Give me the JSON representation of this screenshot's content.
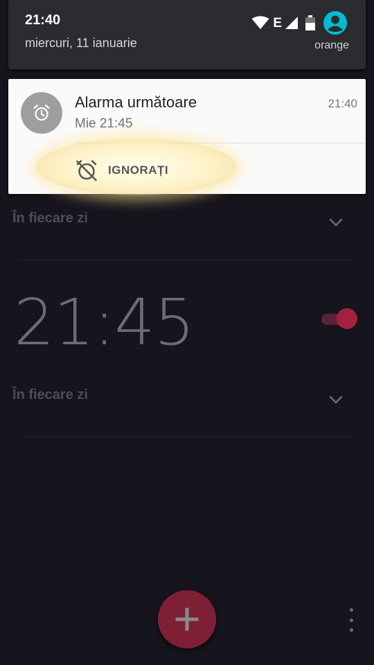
{
  "shade": {
    "time": "21:40",
    "date": "miercuri, 11 ianuarie",
    "carrier": "orange",
    "network_type": "E",
    "icons": [
      "wifi-icon",
      "signal-icon",
      "battery-icon",
      "account-icon"
    ],
    "account_color": "#00bcd4"
  },
  "notification": {
    "title": "Alarma următoare",
    "subtitle": "Mie 21:45",
    "time": "21:40",
    "icon": "alarm-clock-icon",
    "action": {
      "label": "IGNORAȚI",
      "icon": "alarm-off-icon"
    }
  },
  "alarms": [
    {
      "repeat": "În fiecare zi"
    },
    {
      "time": "21:45",
      "enabled": true,
      "repeat": "În fiecare zi"
    }
  ],
  "fab": {
    "icon": "plus-icon",
    "color": "#7f1f35"
  },
  "overflow_menu": {
    "icon": "more-vert-icon"
  },
  "colors": {
    "background": "#16141d",
    "accent": "#a3213f",
    "notification_bg": "#fafafa"
  }
}
